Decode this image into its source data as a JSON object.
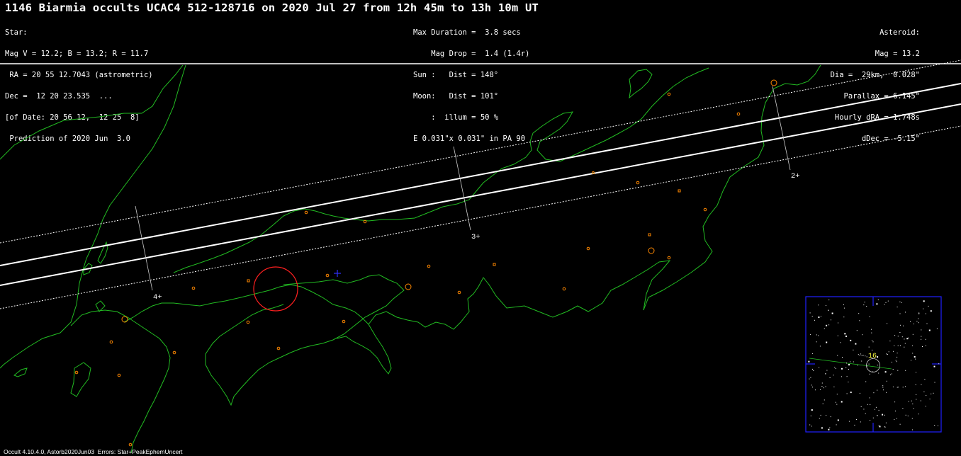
{
  "title": "1146 Biarmia occults UCAC4 512-128716 on 2020 Jul 27 from 12h 45m to 13h 10m UT",
  "star_info": [
    "Star:",
    "Mag V = 12.2; B = 13.2; R = 11.7",
    " RA = 20 55 12.7043 (astrometric)",
    "Dec =  12 20 23.535  ...",
    "[of Date: 20 56 12,  12 25  8]",
    " Prediction of 2020 Jun  3.0"
  ],
  "circumstances": [
    "Max Duration =  3.8 secs",
    "    Mag Drop =  1.4 (1.4r)",
    "Sun :   Dist = 148°",
    "Moon:   Dist = 101°",
    "    :  illum = 50 %",
    "E 0.031\"x 0.031\" in PA 90"
  ],
  "asteroid_info": [
    "Asteroid:",
    "Mag = 13.2",
    "Dia =  29km,  0.028\"",
    "Parallax = 6.145\"",
    "Hourly dRA =-1.748s",
    "dDec = -5.15\""
  ],
  "time_markers": [
    "2+",
    "3+",
    "4+"
  ],
  "finder_chart": {
    "label": "16"
  },
  "footer": "Occult 4.10.4.0, Astorb2020Jun03  Errors: Star+PeakEphemUncert",
  "colors": {
    "coastline": "#22bb22",
    "path_line": "#ffffff",
    "site_marker": "#ff8800",
    "error_ellipse": "#ff2020",
    "finder_border": "#2020ff",
    "finder_label": "#ffff44"
  }
}
